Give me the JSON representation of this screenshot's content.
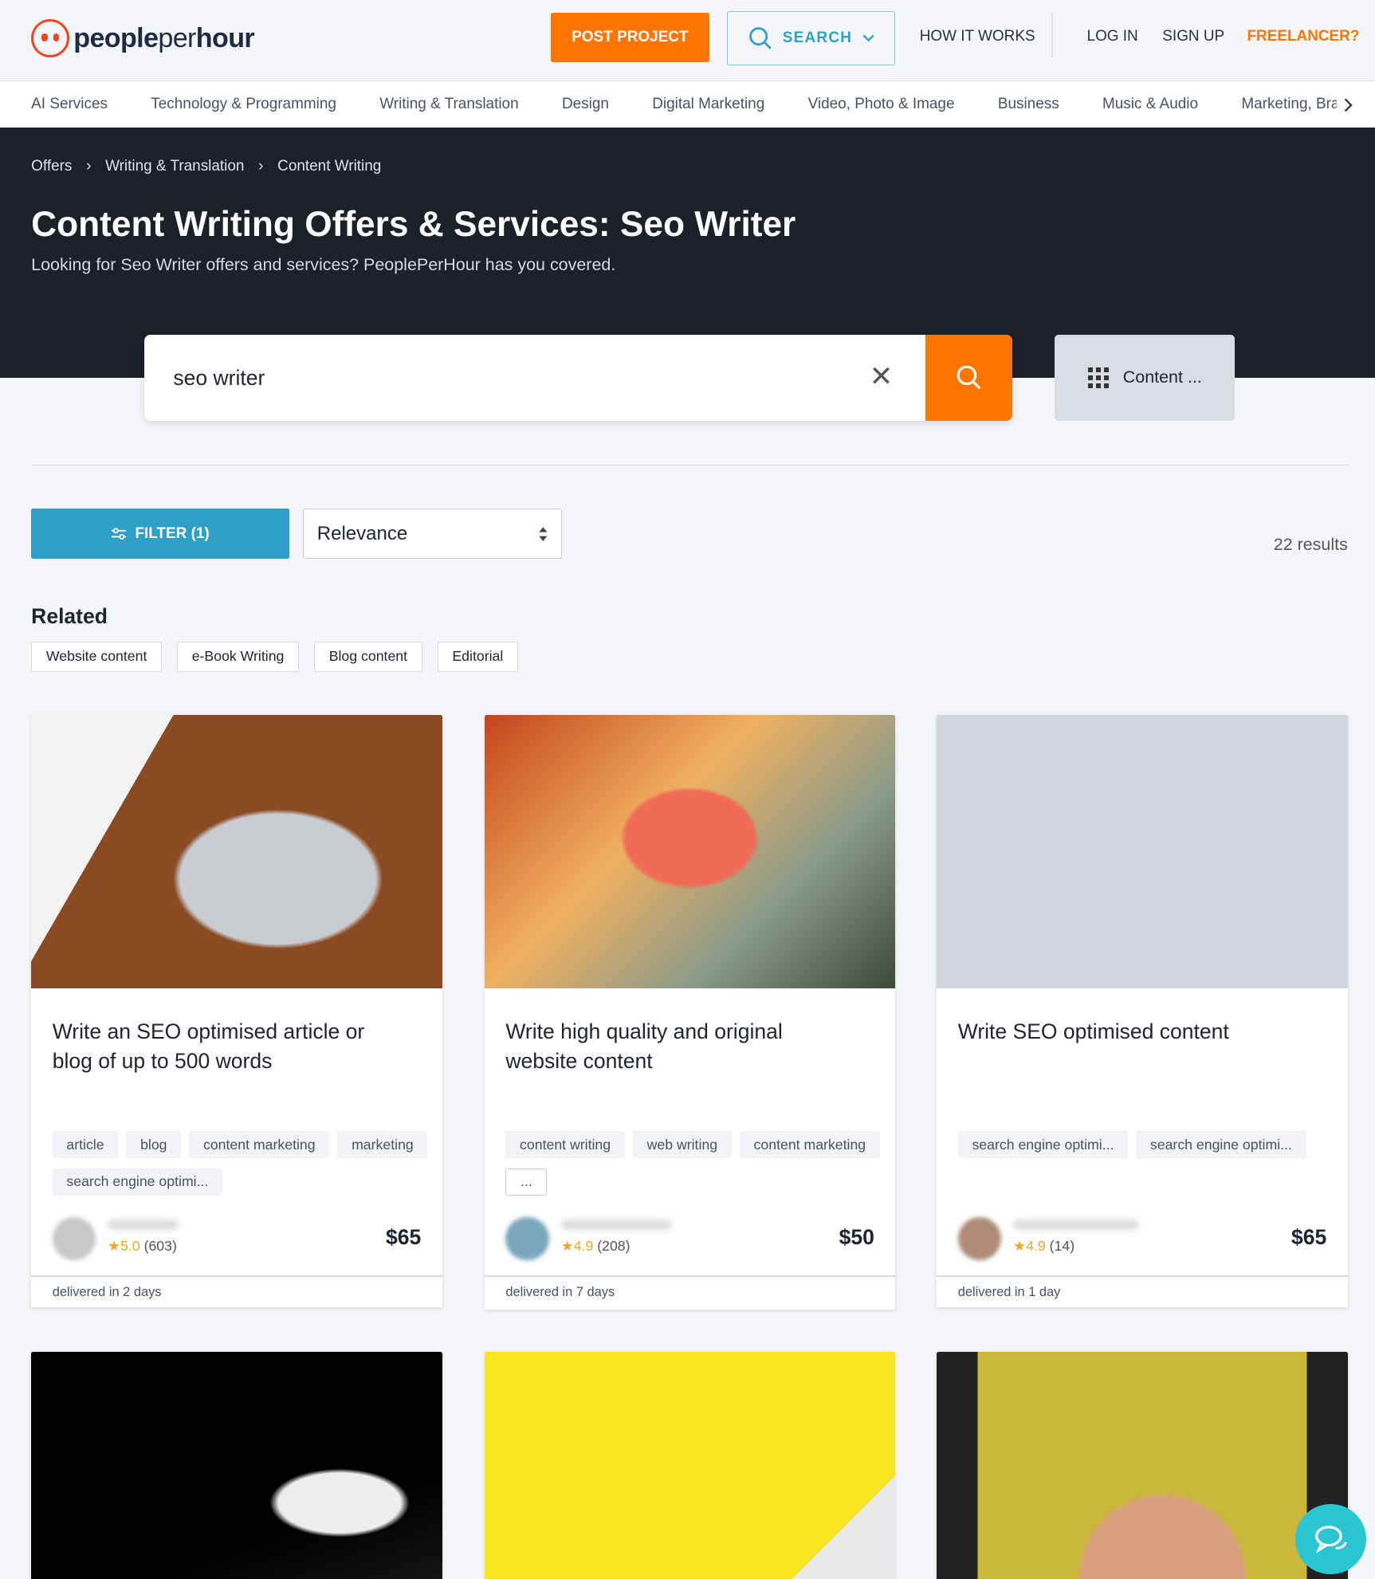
{
  "header": {
    "logo_text_1": "people",
    "logo_text_2": "per",
    "logo_text_3": "hour",
    "post_project": "POST PROJECT",
    "search": "SEARCH",
    "how_it_works": "HOW IT WORKS",
    "log_in": "LOG IN",
    "sign_up": "SIGN UP",
    "freelancer": "FREELANCER?"
  },
  "categories": [
    "AI Services",
    "Technology & Programming",
    "Writing & Translation",
    "Design",
    "Digital Marketing",
    "Video, Photo & Image",
    "Business",
    "Music & Audio",
    "Marketing, Bra"
  ],
  "breadcrumb": [
    "Offers",
    "Writing & Translation",
    "Content Writing"
  ],
  "hero": {
    "title": "Content Writing Offers & Services: Seo Writer",
    "subtitle": "Looking for Seo Writer offers and services? PeoplePerHour has you covered."
  },
  "search": {
    "value": "seo writer",
    "category_button": "Content ..."
  },
  "toolbar": {
    "filter": "FILTER (1)",
    "sort": "Relevance",
    "results": "22 results"
  },
  "related": {
    "title": "Related",
    "chips": [
      "Website content",
      "e-Book Writing",
      "Blog content",
      "Editorial"
    ]
  },
  "cards": [
    {
      "title": "Write an SEO optimised article or blog of up to 500 words",
      "tags": [
        "article",
        "blog",
        "content marketing",
        "marketing",
        "search engine optimi..."
      ],
      "rating": "5.0",
      "reviews": "(603)",
      "price": "$65",
      "delivery": "delivered in 2 days"
    },
    {
      "title": "Write high quality and original website content",
      "tags": [
        "content writing",
        "web writing",
        "content marketing",
        "..."
      ],
      "rating": "4.9",
      "reviews": "(208)",
      "price": "$50",
      "delivery": "delivered in 7 days"
    },
    {
      "title": "Write SEO optimised content",
      "tags": [
        "search engine optimi...",
        "search engine optimi..."
      ],
      "rating": "4.9",
      "reviews": "(14)",
      "price": "$65",
      "delivery": "delivered in 1 day"
    }
  ],
  "colors": {
    "accent": "#ff7500",
    "primary": "#2e9fc7",
    "hero_bg": "#1b2029",
    "chat": "#2cc5d2",
    "star": "#f5a623"
  }
}
